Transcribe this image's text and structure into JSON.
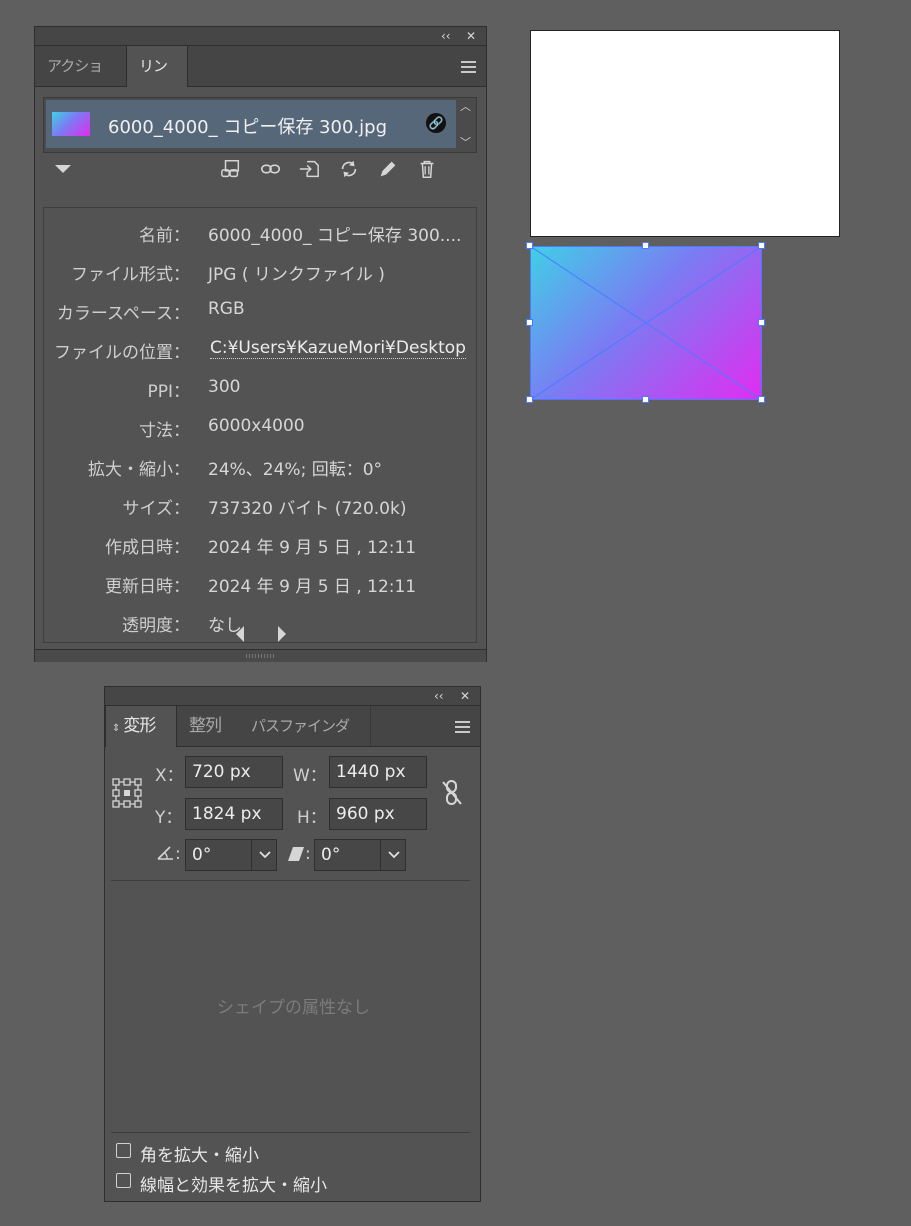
{
  "links_panel": {
    "tabs": [
      "アクション",
      "リンク"
    ],
    "link_item": {
      "filename": "6000_4000_ コピー保存 300.jpg"
    },
    "info": [
      {
        "label": "名前：",
        "value": "6000_4000_ コピー保存 300...."
      },
      {
        "label": "ファイル形式：",
        "value": "JPG ( リンクファイル )"
      },
      {
        "label": "カラースペース：",
        "value": "RGB"
      },
      {
        "label": "ファイルの位置：",
        "value": "C:¥Users¥KazueMori¥Desktop"
      },
      {
        "label": "PPI：",
        "value": "300"
      },
      {
        "label": "寸法：",
        "value": "6000x4000"
      },
      {
        "label": "拡大・縮小：",
        "value": "24%、24%; 回転：0°"
      },
      {
        "label": "サイズ：",
        "value": "737320 バイト (720.0k)"
      },
      {
        "label": "作成日時：",
        "value": "2024 年 9 月 5 日 , 12:11"
      },
      {
        "label": "更新日時：",
        "value": "2024 年 9 月 5 日 , 12:11"
      },
      {
        "label": "透明度：",
        "value": "なし"
      }
    ]
  },
  "transform_panel": {
    "tabs": [
      "変形",
      "整列",
      "パスファインダー"
    ],
    "x_label": "X：",
    "x_value": "720 px",
    "y_label": "Y：",
    "y_value": "1824 px",
    "w_label": "W：",
    "w_value": "1440 px",
    "h_label": "H：",
    "h_value": "960 px",
    "rotate_suffix": ":",
    "rotate_value": "0°",
    "shear_suffix": ":",
    "shear_value": "0°",
    "empty_message": "シェイプの属性なし",
    "checkbox_scale_corners": "角を拡大・縮小",
    "checkbox_scale_strokes": "線幅と効果を拡大・縮小"
  },
  "colors": {
    "panel_bg": "#535353",
    "canvas_bg": "#5f5f5f",
    "selection_blue": "#4a7bff",
    "gradient_start": "#3fd0e6",
    "gradient_end": "#e22cf0"
  }
}
